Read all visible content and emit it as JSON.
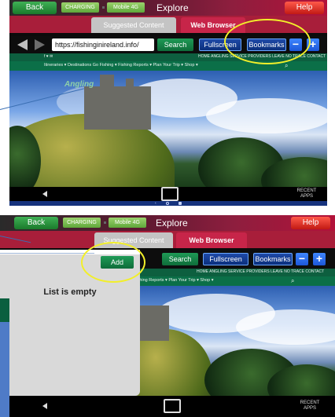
{
  "top": {
    "back": "Back",
    "charging": "CHARGING",
    "network": "Mobile 4G",
    "title": "Explore",
    "help": "Help"
  },
  "tabs": {
    "suggested": "Suggested Content",
    "web": "Web Browser"
  },
  "toolbar": {
    "url": "https://fishinginireland.info/",
    "search": "Search",
    "fullscreen": "Fullscreen",
    "bookmarks": "Bookmarks",
    "minus": "−",
    "plus": "+"
  },
  "site": {
    "top_links": "HOME   ANGLING SERVICE PROVIDERS   LEAVE NO TRACE   CONTACT",
    "social": "f  ♥  ✉",
    "menu": "Itineraries ▾     Destinations     Go Fishing ▾     Fishing Reports ▾     Plan Your Trip ▾     Shop ▾",
    "logo": "Angling"
  },
  "nav": {
    "recent": "RECENT\nAPPS"
  },
  "bookmarks_panel": {
    "add": "Add",
    "empty": "List is empty",
    "menu_partial": "Fishing Reports ▾     Plan Your Trip ▾     Shop ▾",
    "top_links_partial": "HOME   ANGLING SERVICE PROVIDERS   LEAVE NO TRACE   CONTACT"
  },
  "colors": {
    "highlight": "#f2ef2a",
    "accent_red": "#b2123a",
    "accent_green": "#0f6d3a",
    "accent_blue": "#1c56d8"
  }
}
